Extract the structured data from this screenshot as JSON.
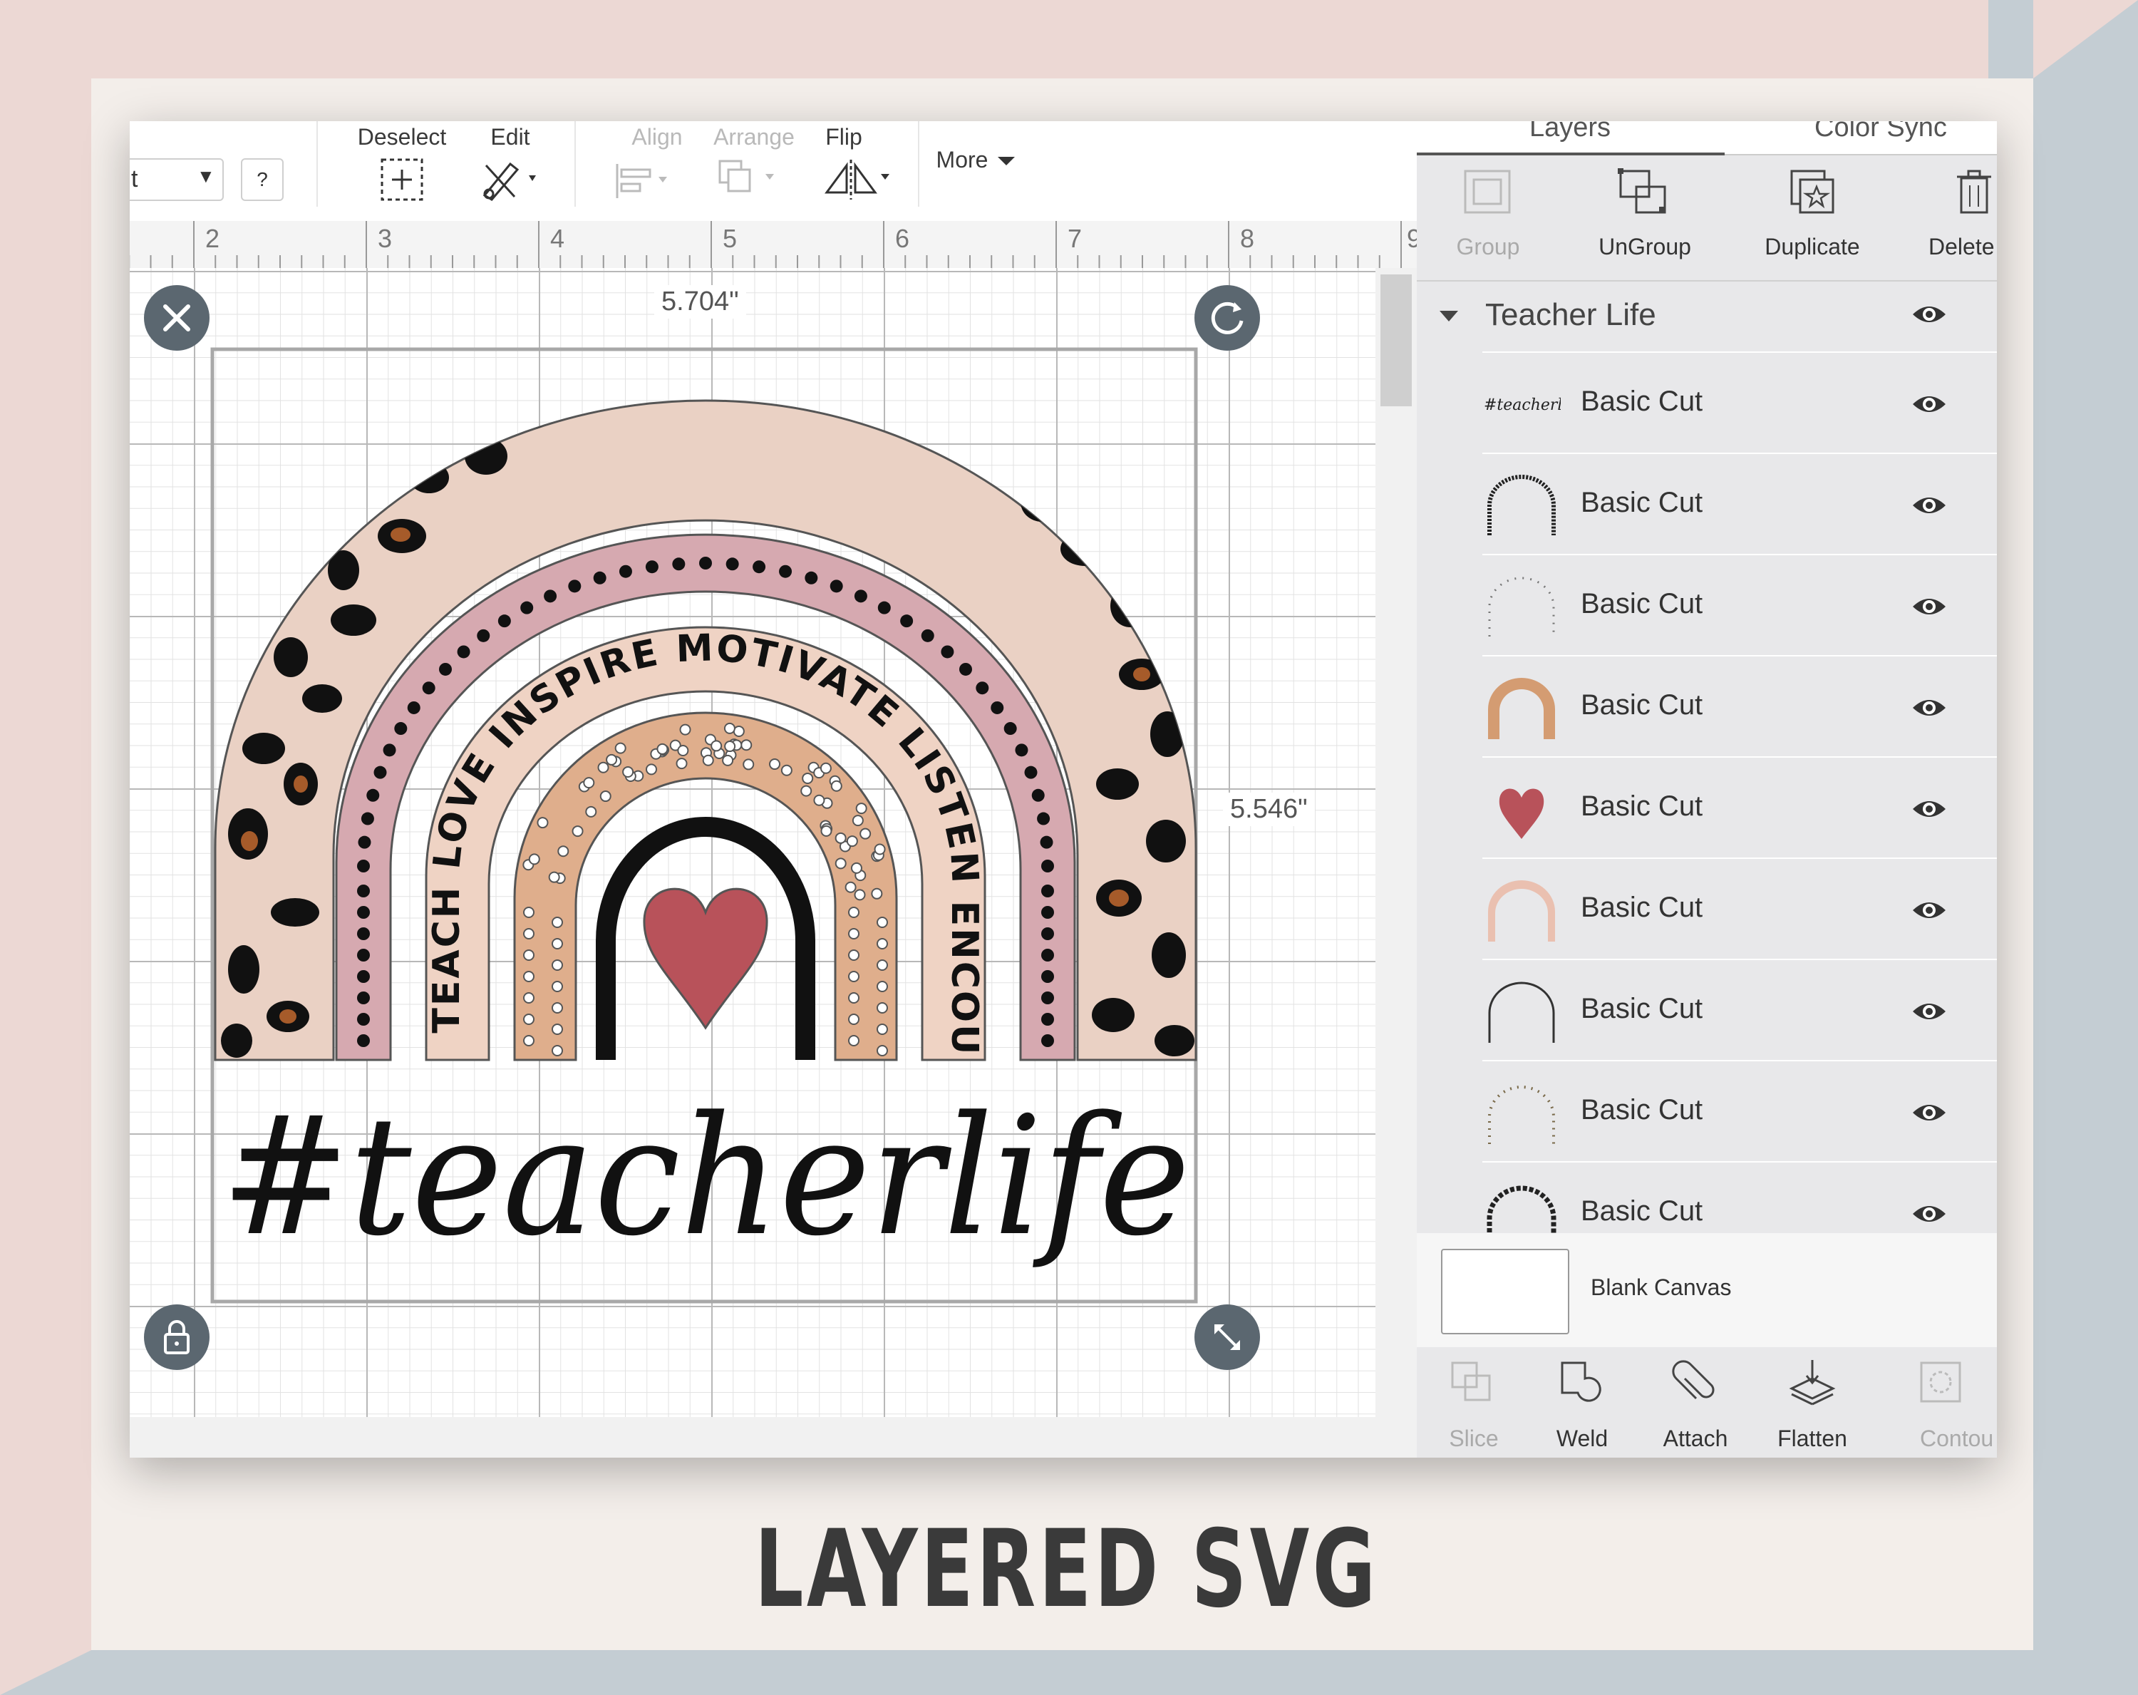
{
  "toolbar": {
    "select_value": "t",
    "help_label": "?",
    "deselect_label": "Deselect",
    "edit_label": "Edit",
    "align_label": "Align",
    "arrange_label": "Arrange",
    "flip_label": "Flip",
    "more_label": "More"
  },
  "ruler": {
    "numbers": [
      "2",
      "3",
      "4",
      "5",
      "6",
      "7",
      "8",
      "9"
    ]
  },
  "canvas": {
    "width_label": "5.704\"",
    "height_label": "5.546\"",
    "design_text": "#teacherlife",
    "arc_text": "TEACH LOVE INSPIRE MOTIVATE LISTEN ENCOURAGE"
  },
  "panel": {
    "tabs": {
      "layers": "Layers",
      "color_sync": "Color Sync"
    },
    "actions": {
      "group": "Group",
      "ungroup": "UnGroup",
      "duplicate": "Duplicate",
      "delete": "Delete"
    },
    "group_title": "Teacher Life",
    "layers": [
      {
        "name": "Basic Cut",
        "thumb": "teacherlife-text"
      },
      {
        "name": "Basic Cut",
        "thumb": "dark-arc-text"
      },
      {
        "name": "Basic Cut",
        "thumb": "dotted-arc"
      },
      {
        "name": "Basic Cut",
        "thumb": "tan-arc"
      },
      {
        "name": "Basic Cut",
        "thumb": "heart"
      },
      {
        "name": "Basic Cut",
        "thumb": "pink-arc"
      },
      {
        "name": "Basic Cut",
        "thumb": "black-outline-arc"
      },
      {
        "name": "Basic Cut",
        "thumb": "dots-arc"
      },
      {
        "name": "Basic Cut",
        "thumb": "leopard-arc"
      }
    ],
    "blank_canvas": "Blank Canvas",
    "bottom_actions": {
      "slice": "Slice",
      "weld": "Weld",
      "attach": "Attach",
      "flatten": "Flatten",
      "contour": "Contou"
    }
  },
  "caption": "LAYERED SVG",
  "colors": {
    "leopard_base": "#ead1c4",
    "pink_band": "#d6a9b0",
    "tan_band": "#dfae8c",
    "heart": "#b8525a",
    "spot_brown": "#a65b2a"
  }
}
